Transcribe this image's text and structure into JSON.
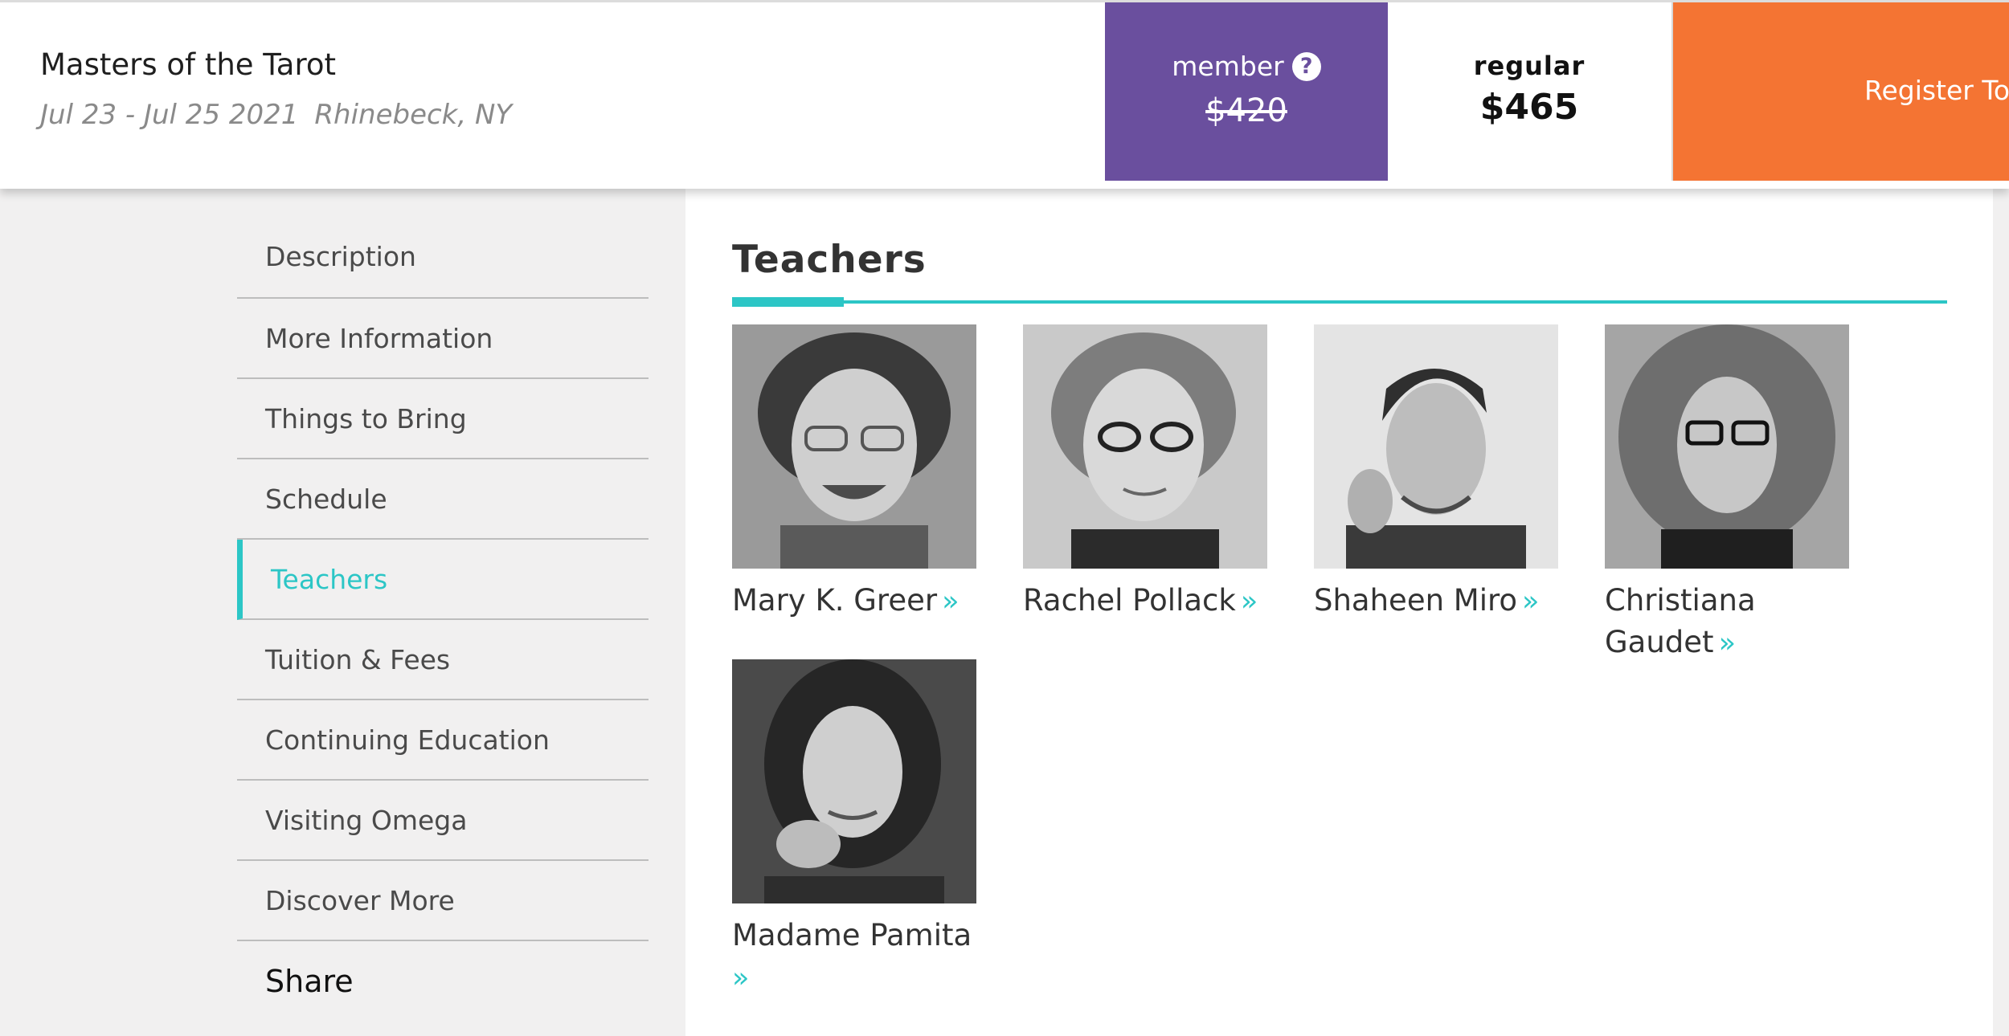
{
  "header": {
    "title": "Masters of the Tarot",
    "dates": "Jul 23 - Jul 25 2021",
    "location": "Rhinebeck, NY",
    "member_label": "member",
    "member_price": "$420",
    "regular_label": "regular",
    "regular_price": "$465",
    "register_label": "Register Today"
  },
  "nav": {
    "items": [
      {
        "label": "Description"
      },
      {
        "label": "More Information"
      },
      {
        "label": "Things to Bring"
      },
      {
        "label": "Schedule"
      },
      {
        "label": "Teachers",
        "active": true
      },
      {
        "label": "Tuition & Fees"
      },
      {
        "label": "Continuing Education"
      },
      {
        "label": "Visiting Omega"
      },
      {
        "label": "Discover More"
      }
    ],
    "share_label": "Share"
  },
  "main": {
    "section_title": "Teachers",
    "teachers": [
      {
        "name": "Mary K. Greer"
      },
      {
        "name": "Rachel Pollack"
      },
      {
        "name": "Shaheen Miro"
      },
      {
        "name": "Christiana Gaudet"
      },
      {
        "name": "Madame Pamita"
      }
    ],
    "chevron_icon": "double-chevron-right-icon"
  },
  "colors": {
    "accent_teal": "#2cc6c6",
    "member_purple": "#6a4f9e",
    "register_orange": "#f47433"
  }
}
